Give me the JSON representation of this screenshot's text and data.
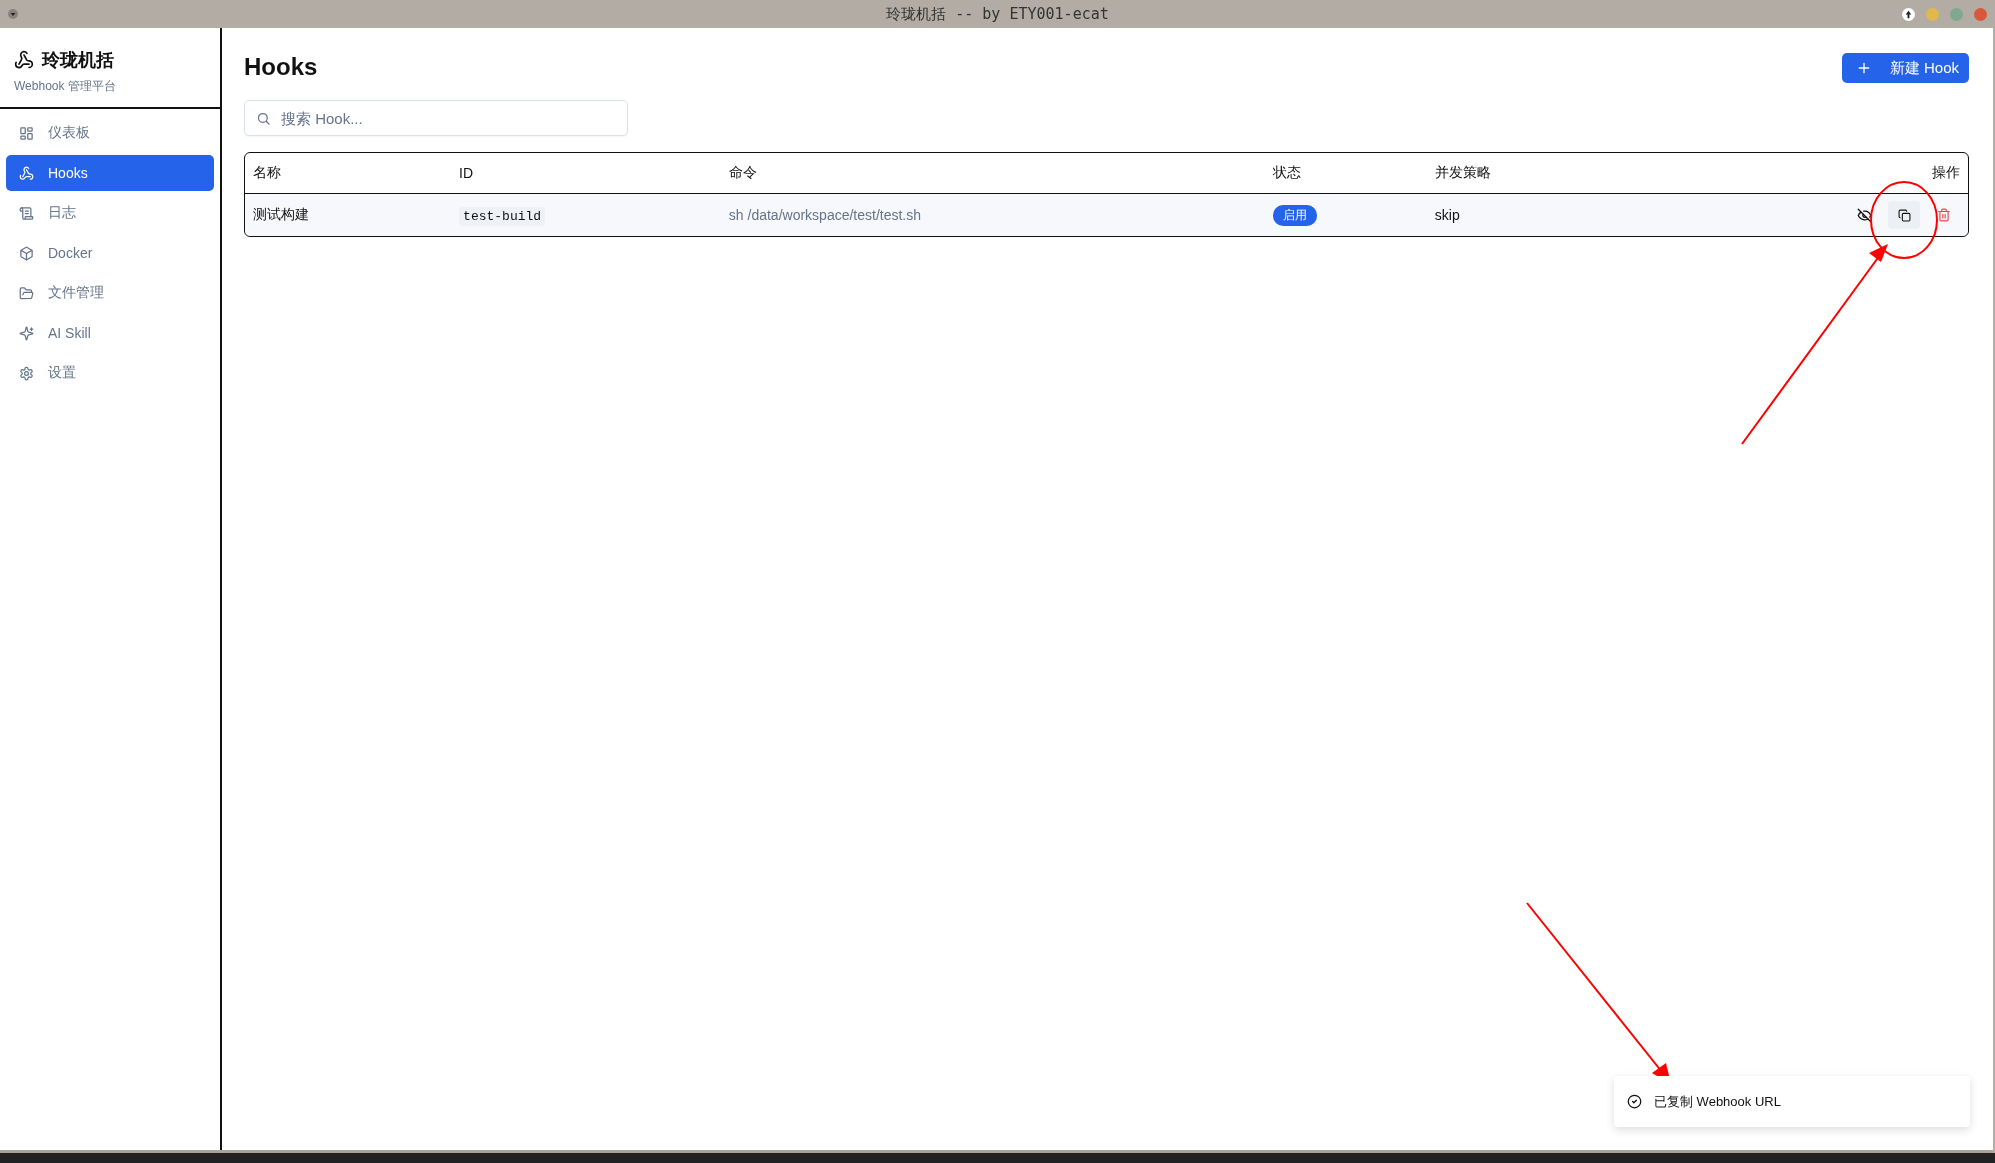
{
  "window": {
    "title": "玲珑机括 -- by ETY001-ecat"
  },
  "sidebar": {
    "brand": "玲珑机括",
    "subtitle": "Webhook 管理平台",
    "items": [
      {
        "label": "仪表板",
        "selected": false
      },
      {
        "label": "Hooks",
        "selected": true
      },
      {
        "label": "日志",
        "selected": false
      },
      {
        "label": "Docker",
        "selected": false
      },
      {
        "label": "文件管理",
        "selected": false
      },
      {
        "label": "AI Skill",
        "selected": false
      },
      {
        "label": "设置",
        "selected": false
      }
    ]
  },
  "page": {
    "title": "Hooks",
    "new_button": "新建 Hook",
    "search": {
      "placeholder": "搜索 Hook..."
    }
  },
  "table": {
    "columns": [
      "名称",
      "ID",
      "命令",
      "状态",
      "并发策略",
      "操作"
    ],
    "rows": [
      {
        "name": "测试构建",
        "id": "test-build",
        "command": "sh /data/workspace/test/test.sh",
        "status": "启用",
        "enabled": true,
        "concurrency": "skip"
      }
    ]
  },
  "toast": {
    "message": "已复制 Webhook URL"
  }
}
